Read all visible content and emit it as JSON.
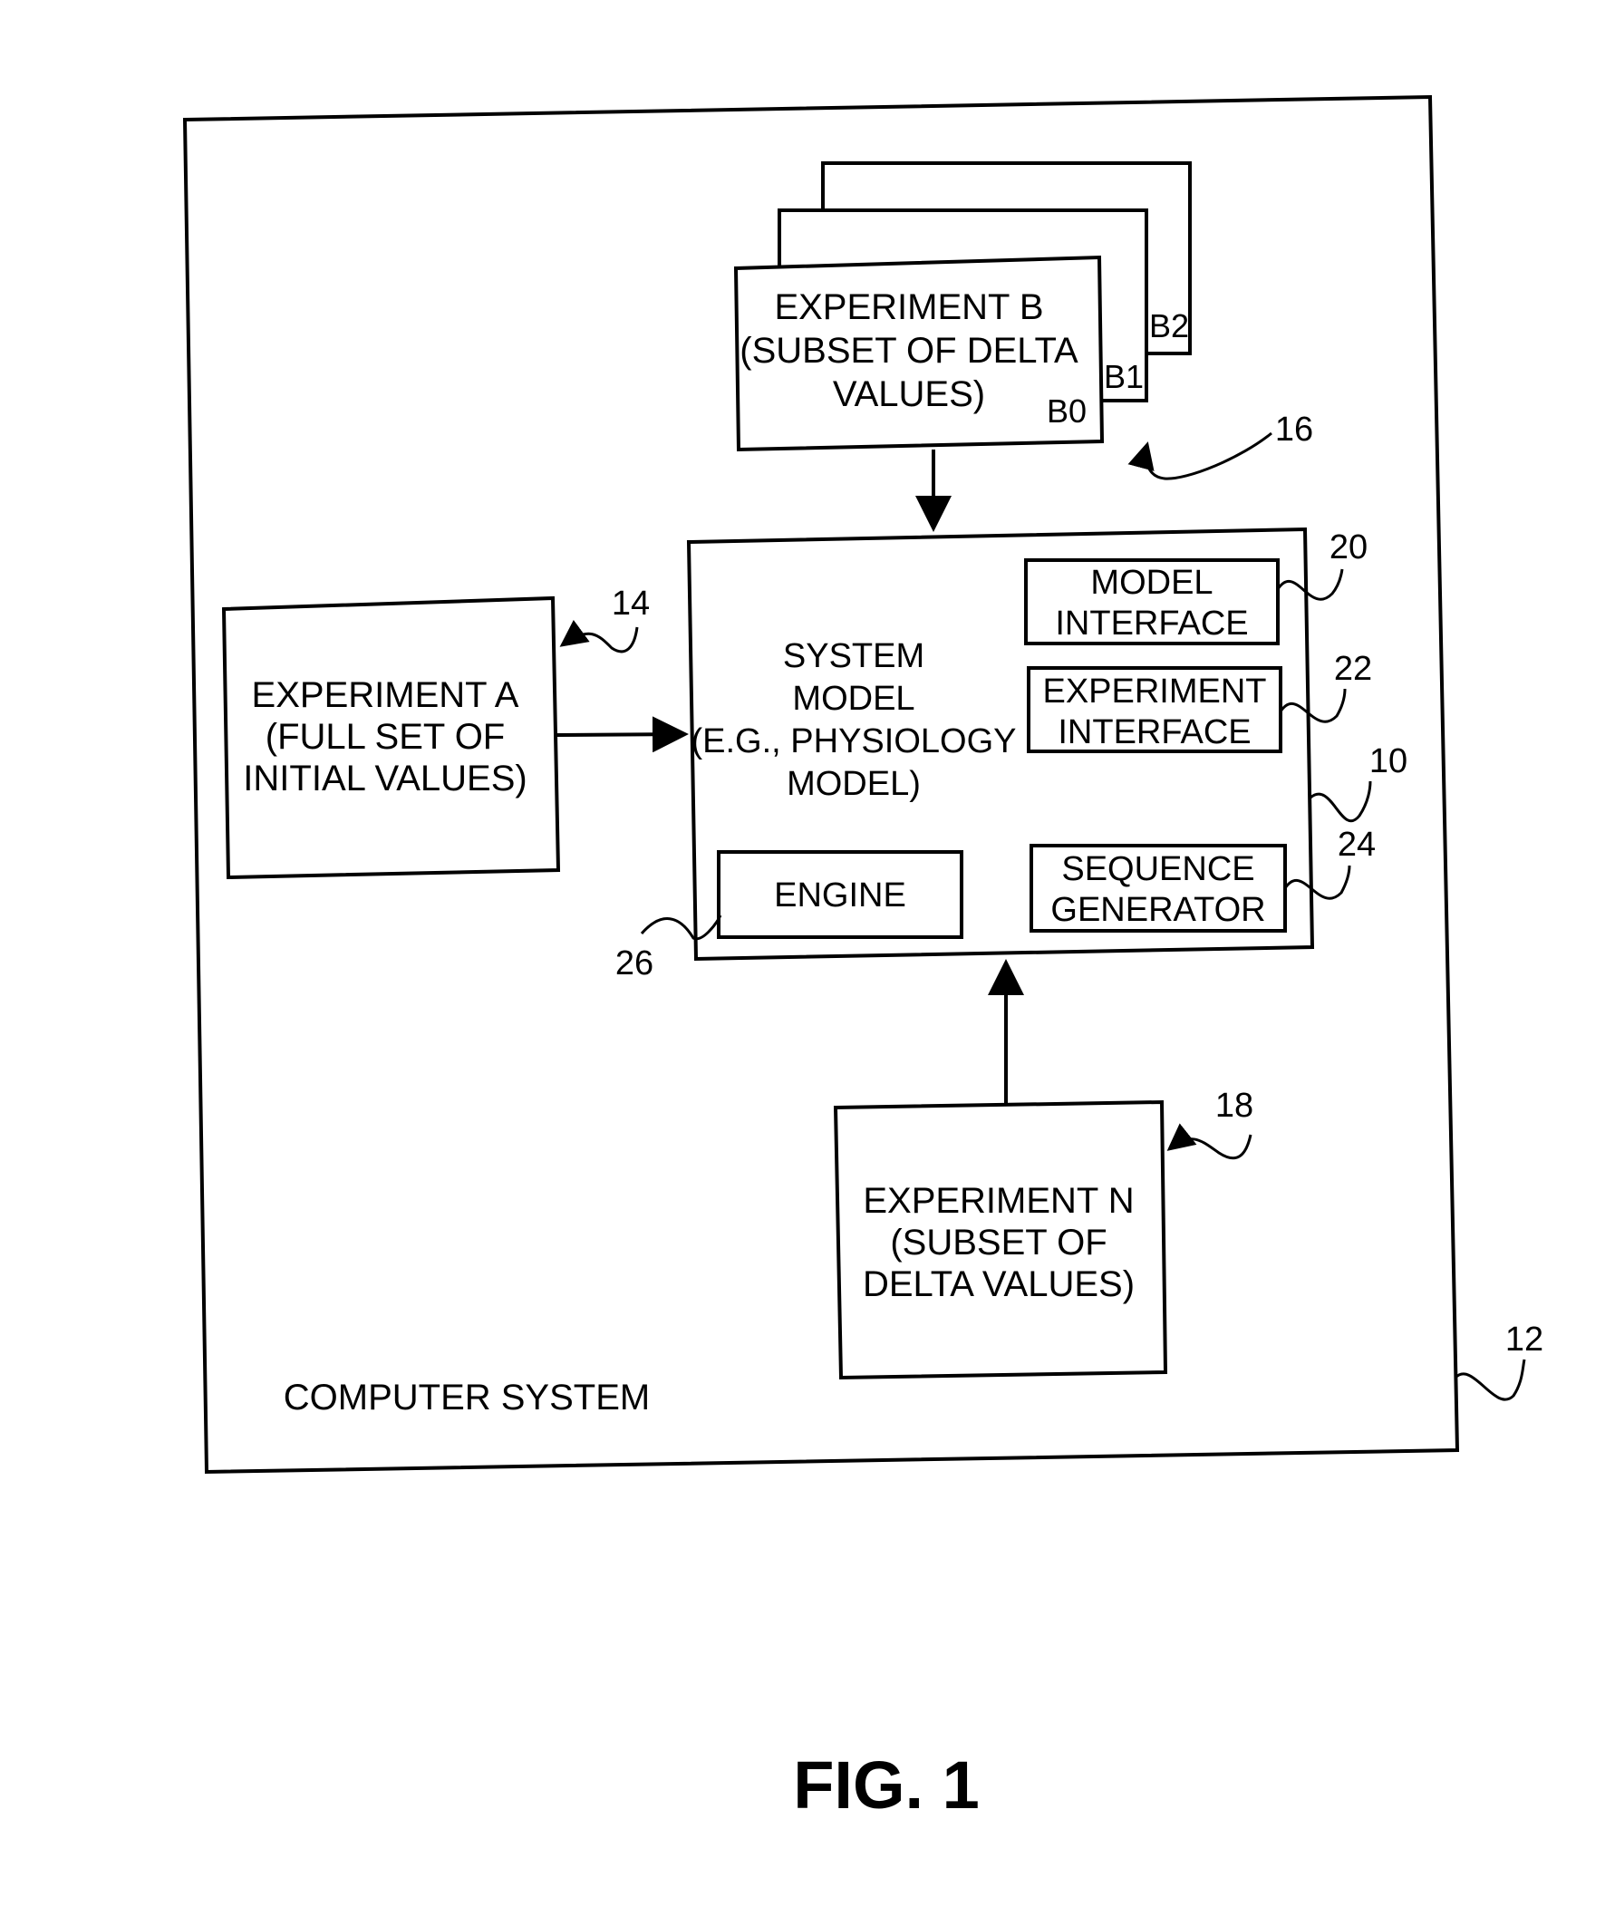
{
  "figure": {
    "caption": "FIG. 1",
    "computer_system": {
      "label": "COMPUTER SYSTEM",
      "ref": "12"
    },
    "system_model": {
      "lines": [
        "SYSTEM",
        "MODEL",
        "(E.G., PHYSIOLOGY",
        "MODEL)"
      ],
      "ref": "10",
      "components": {
        "model_interface": {
          "lines": [
            "MODEL",
            "INTERFACE"
          ],
          "ref": "20"
        },
        "experiment_interface": {
          "lines": [
            "EXPERIMENT",
            "INTERFACE"
          ],
          "ref": "22"
        },
        "sequence_generator": {
          "lines": [
            "SEQUENCE",
            "GENERATOR"
          ],
          "ref": "24"
        },
        "engine": {
          "lines": [
            "ENGINE"
          ],
          "ref": "26"
        }
      }
    },
    "experiment_a": {
      "lines": [
        "EXPERIMENT A",
        "(FULL SET OF",
        "INITIAL VALUES)"
      ],
      "ref": "14"
    },
    "experiment_b": {
      "lines": [
        "EXPERIMENT B",
        "(SUBSET OF DELTA",
        "VALUES)"
      ],
      "ref": "16",
      "stack_tags": [
        "B0",
        "B1",
        "B2"
      ]
    },
    "experiment_n": {
      "lines": [
        "EXPERIMENT N",
        "(SUBSET OF",
        "DELTA VALUES)"
      ],
      "ref": "18"
    }
  }
}
